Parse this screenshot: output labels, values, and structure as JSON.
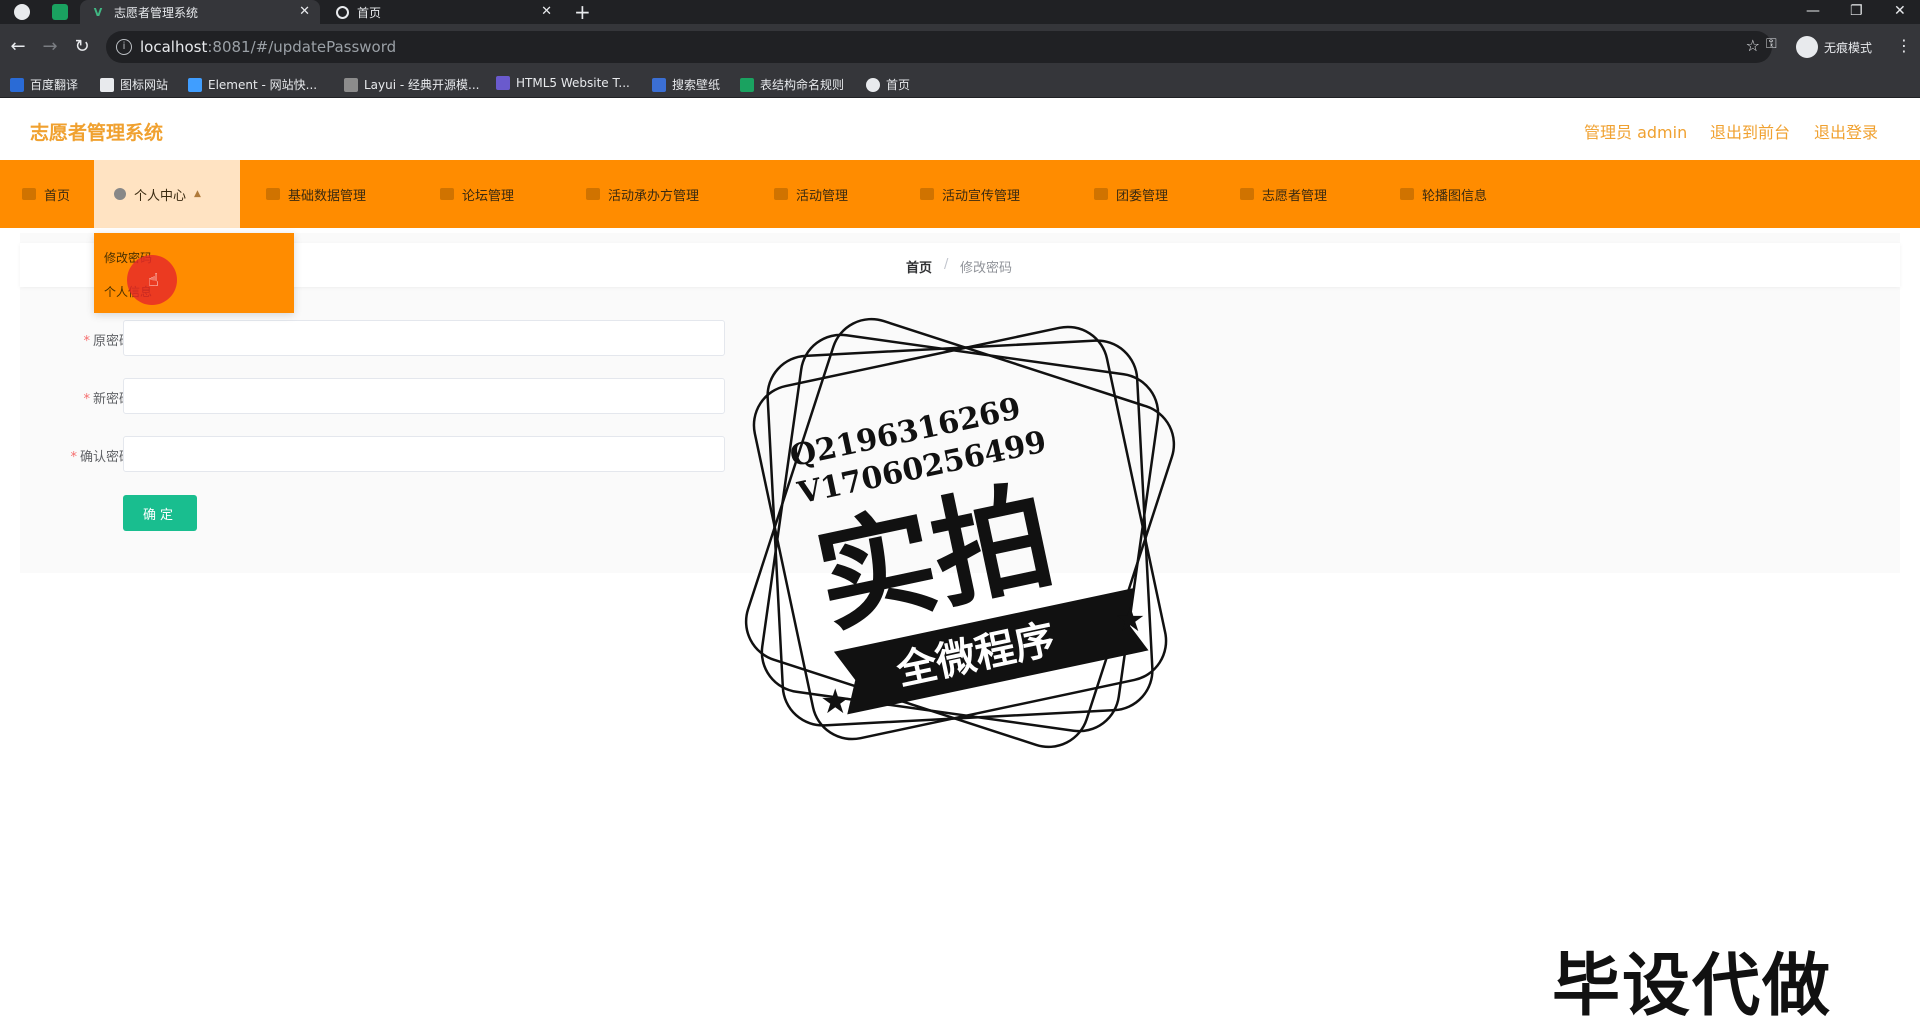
{
  "browser": {
    "tabs": [
      {
        "title": "志愿者管理系统",
        "active": true
      },
      {
        "title": "首页",
        "active": false
      }
    ],
    "url_host": "localhost",
    "url_path": ":8081/#/updatePassword",
    "profile_label": "无痕模式",
    "bookmarks": [
      "百度翻译",
      "图标网站",
      "Element - 网站快...",
      "Layui - 经典开源模...",
      "HTML5 Website T...",
      "搜索壁纸",
      "表结构命名规则",
      "首页"
    ]
  },
  "header": {
    "title": "志愿者管理系统",
    "admin": "管理员 admin",
    "to_front": "退出到前台",
    "logout": "退出登录"
  },
  "nav": {
    "items": [
      "首页",
      "个人中心",
      "基础数据管理",
      "论坛管理",
      "活动承办方管理",
      "活动管理",
      "活动宣传管理",
      "团委管理",
      "志愿者管理",
      "轮播图信息"
    ],
    "submenu": [
      "修改密码",
      "个人信息"
    ]
  },
  "breadcrumb": {
    "home": "首页",
    "sep": "/",
    "current": "修改密码"
  },
  "form": {
    "fields": [
      {
        "label": "原密码",
        "value": ""
      },
      {
        "label": "新密码",
        "value": ""
      },
      {
        "label": "确认密码",
        "value": ""
      }
    ],
    "submit": "确定"
  },
  "watermark": {
    "qq": "Q2196316269",
    "wx": "V17060256499",
    "main": "实拍",
    "ribbon": "全微程序",
    "corner": "毕设代做"
  },
  "colors": {
    "accent": "#ff8c00",
    "title": "#f0a130",
    "button": "#19be8f"
  }
}
